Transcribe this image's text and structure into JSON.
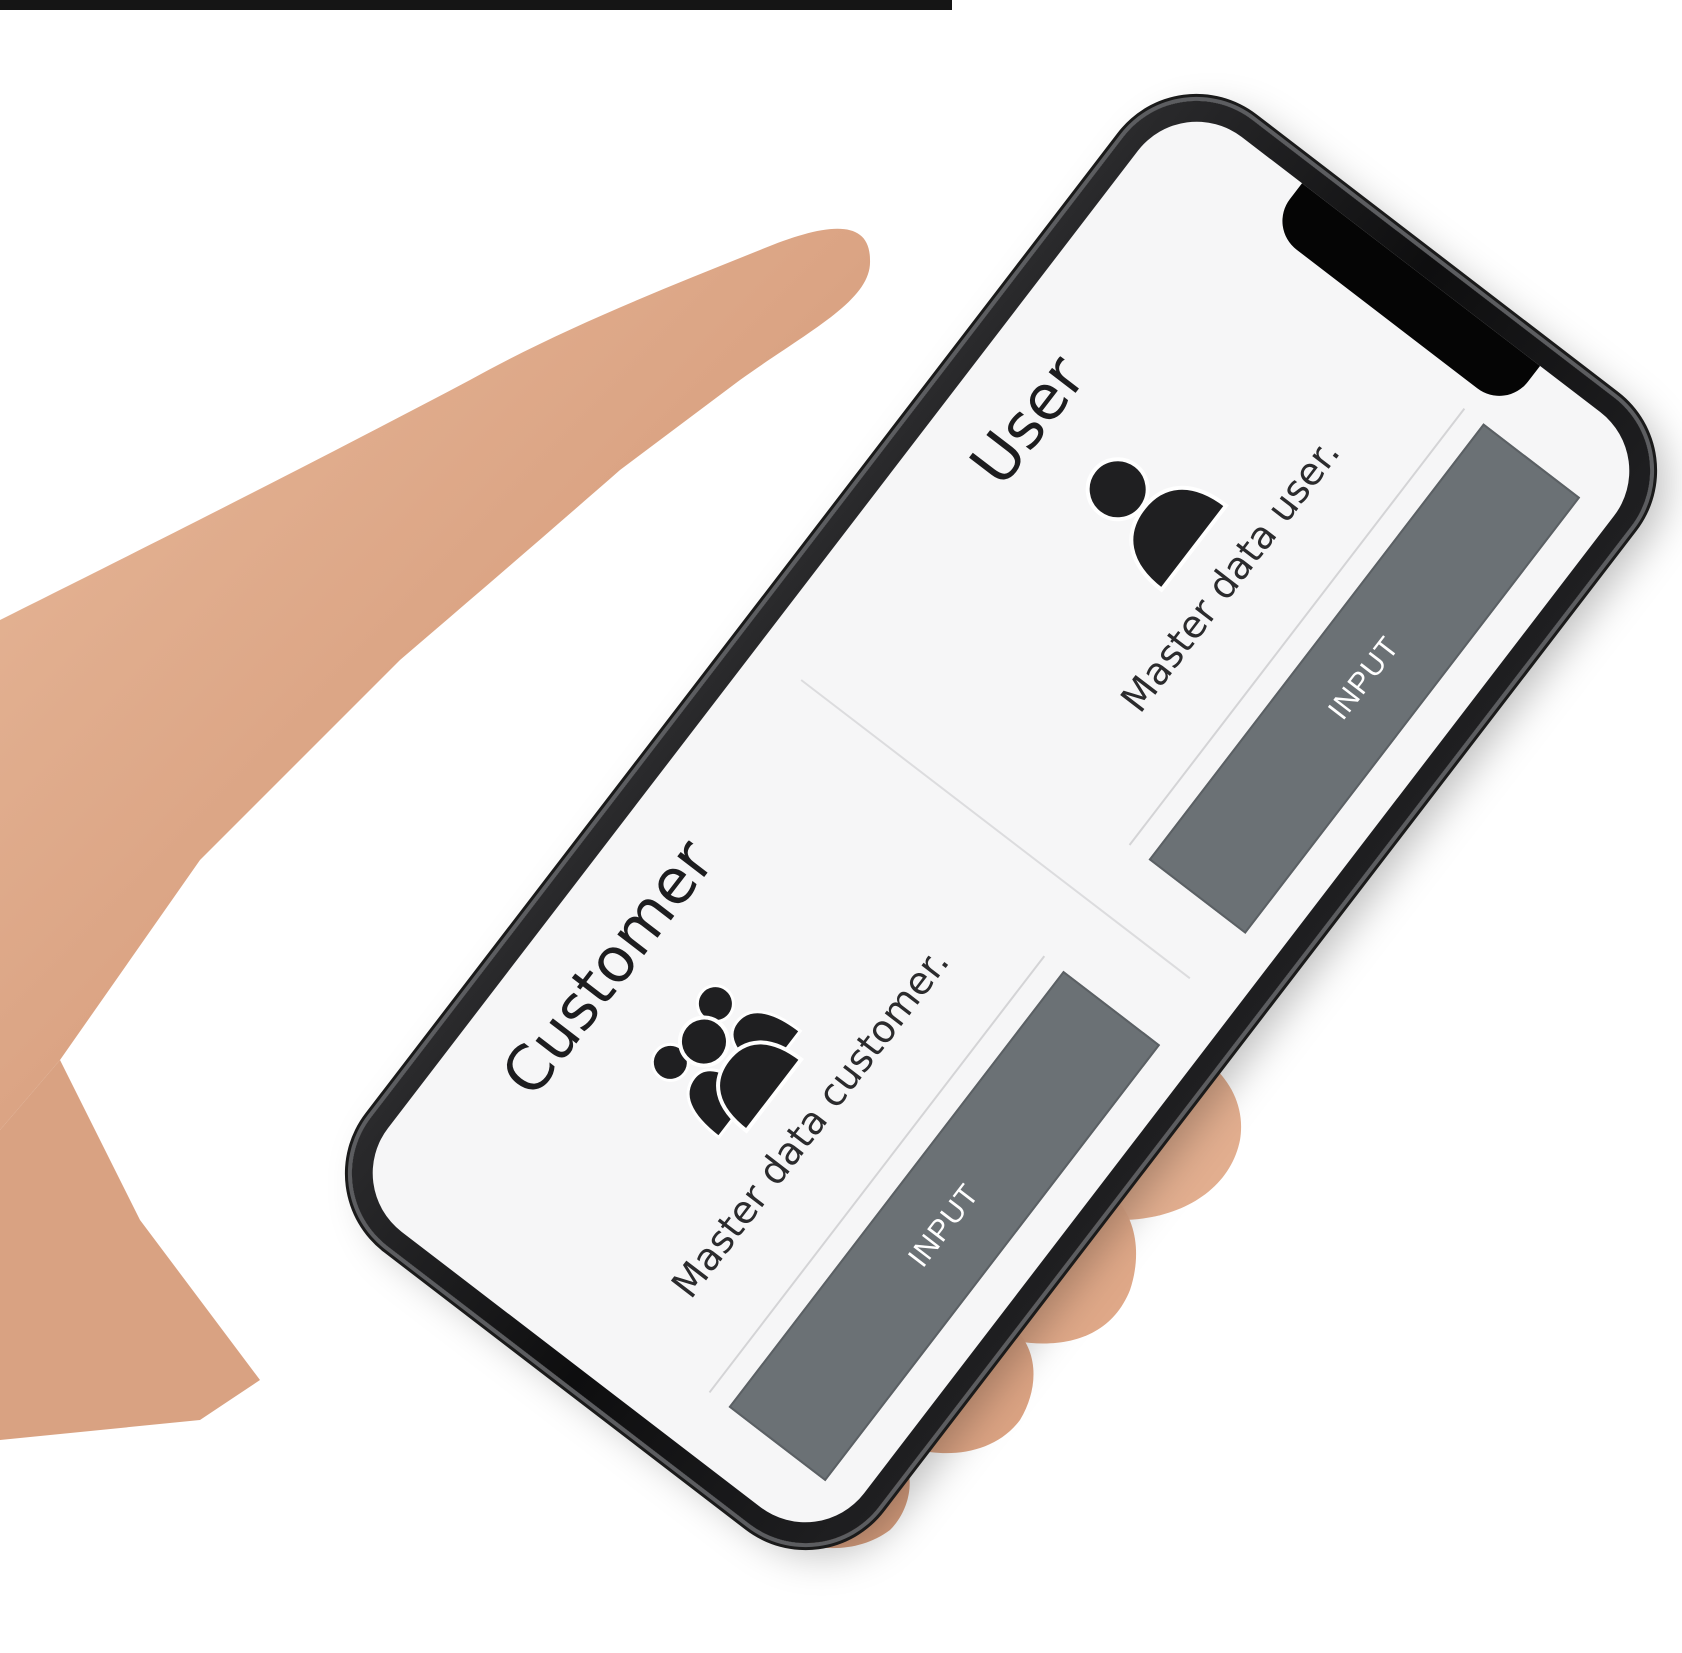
{
  "cards": [
    {
      "title": "Customer",
      "description": "Master data customer.",
      "button_label": "INPUT",
      "icon": "users-group-icon"
    },
    {
      "title": "User",
      "description": "Master data user.",
      "button_label": "INPUT",
      "icon": "user-icon"
    }
  ],
  "colors": {
    "button_bg": "#6b7175",
    "screen_bg": "#f6f6f7",
    "icon_fill": "#1f1f21"
  }
}
